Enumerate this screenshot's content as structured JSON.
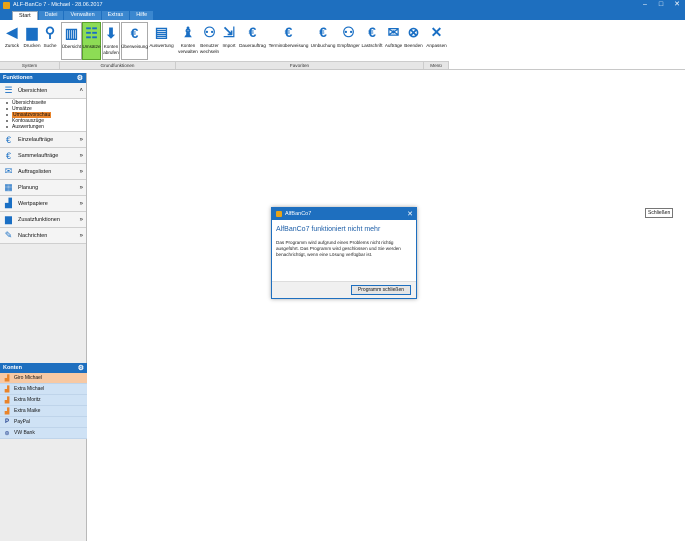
{
  "window": {
    "title": "ALF-BanCo 7 - Michael - 28.06.2017",
    "minimize": "–",
    "maximize": "□",
    "close": "✕"
  },
  "menu_tabs": [
    {
      "label": "Start"
    },
    {
      "label": "Datei"
    },
    {
      "label": "Verwalten"
    },
    {
      "label": "Extras"
    },
    {
      "label": "Hilfe"
    }
  ],
  "ribbon": {
    "buttons": [
      {
        "label": "Zurück",
        "icon": "back-arrow-icon"
      },
      {
        "label": "Drucken",
        "icon": "printer-icon"
      },
      {
        "label": "Suche",
        "icon": "search-icon"
      },
      {
        "label": "Übersicht",
        "icon": "overview-icon"
      },
      {
        "label": "Umsätze",
        "icon": "transactions-icon"
      },
      {
        "label": "Konten\nabrufen",
        "icon": "download-icon"
      },
      {
        "label": "Überweisung",
        "icon": "euro-icon"
      },
      {
        "label": "Auswertung",
        "icon": "report-icon"
      },
      {
        "label": "Konten\nverwalten",
        "icon": "money-bag-icon"
      },
      {
        "label": "Benutzer\nwechseln",
        "icon": "user-switch-icon"
      },
      {
        "label": "Import",
        "icon": "import-icon"
      },
      {
        "label": "Dauerauftrag",
        "icon": "euro-recurring-icon"
      },
      {
        "label": "Terminüberweisung",
        "icon": "euro-scheduled-icon"
      },
      {
        "label": "Umbuchung",
        "icon": "euro-transfer-icon"
      },
      {
        "label": "Empfänger",
        "icon": "recipient-icon"
      },
      {
        "label": "Lastschrift",
        "icon": "euro-debit-icon"
      },
      {
        "label": "Aufträge",
        "icon": "mail-icon"
      },
      {
        "label": "Beenden",
        "icon": "exit-icon"
      },
      {
        "label": "Anpassen",
        "icon": "tools-icon"
      }
    ],
    "groups": [
      {
        "label": "System"
      },
      {
        "label": "Grundfunktionen"
      },
      {
        "label": "Favoriten"
      },
      {
        "label": "Menü"
      }
    ]
  },
  "funktionen": {
    "header": "Funktionen",
    "items": [
      {
        "label": "Übersichten",
        "chev": "»"
      },
      {
        "label": "Einzelaufträge",
        "chev": "»"
      },
      {
        "label": "Sammelaufträge",
        "chev": "»"
      },
      {
        "label": "Auftragslisten",
        "chev": "»"
      },
      {
        "label": "Planung",
        "chev": "»"
      },
      {
        "label": "Wertpapiere",
        "chev": "»"
      },
      {
        "label": "Zusatzfunktionen",
        "chev": "»"
      },
      {
        "label": "Nachrichten",
        "chev": "»"
      }
    ],
    "sub_items": [
      {
        "label": "Übersichtsseite"
      },
      {
        "label": "Umsätze"
      },
      {
        "label": "Umsatzvorschau"
      },
      {
        "label": "Kontoauszüge"
      },
      {
        "label": "Auswertungen"
      }
    ]
  },
  "konten": {
    "header": "Konten",
    "items": [
      {
        "label": "Giro Michael"
      },
      {
        "label": "Extra Michael"
      },
      {
        "label": "Extra Moritz"
      },
      {
        "label": "Extra Maike"
      },
      {
        "label": "PayPal"
      },
      {
        "label": "VW Bank"
      }
    ]
  },
  "tooltip": {
    "label": "Schließen"
  },
  "dialog": {
    "title": "AlfBanCo7",
    "close": "✕",
    "heading": "AlfBanCo7 funktioniert nicht mehr",
    "message": "Das Programm wird aufgrund eines Problems nicht richtig ausgeführt. Das Programm wird geschlossen und Sie werden benachrichtigt, wenn eine Lösung verfügbar ist.",
    "button": "Programm schließen"
  },
  "colors": {
    "brand_blue": "#1e6fbf",
    "selected_orange": "#e9842b",
    "highlight_green": "#8ddc55"
  }
}
